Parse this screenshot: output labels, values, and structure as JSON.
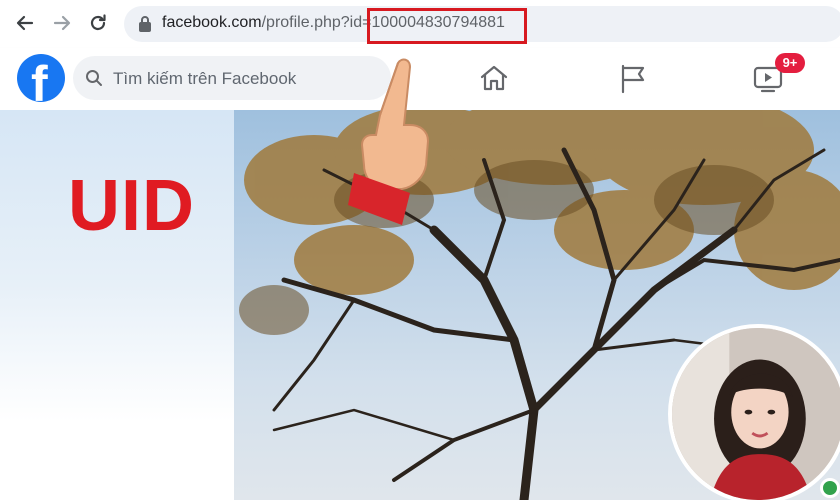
{
  "browser": {
    "url_host": "facebook.com",
    "url_path": "/profile.php?id=",
    "url_id": "100004830794881",
    "icons": {
      "back": "arrow-left-icon",
      "forward": "arrow-right-icon",
      "reload": "reload-icon",
      "lock": "lock-icon"
    }
  },
  "facebook": {
    "search_placeholder": "Tìm kiếm trên Facebook",
    "notification_badge": "9+",
    "icons": {
      "logo": "facebook-logo",
      "home": "home-icon",
      "pages": "flag-icon",
      "watch": "video-icon",
      "search": "search-icon"
    }
  },
  "overlay": {
    "uid_label": "UID"
  },
  "colors": {
    "facebook_blue": "#1877f2",
    "highlight_red": "#d71920",
    "uid_text_red": "#e01b22",
    "badge_red": "#e41e3f"
  }
}
